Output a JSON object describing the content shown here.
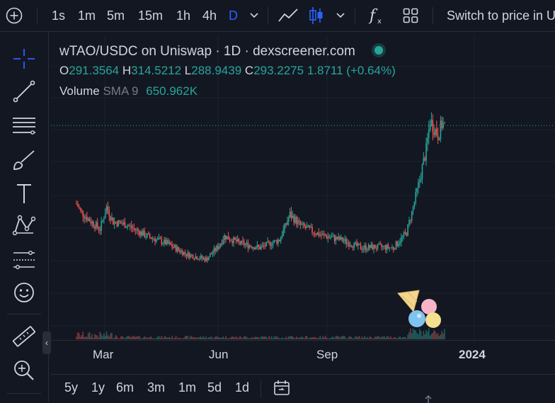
{
  "toolbar": {
    "timeframes": [
      "1s",
      "1m",
      "5m",
      "15m",
      "1h",
      "4h",
      "D"
    ],
    "active_timeframe": "D",
    "switch_label": "Switch to price in U"
  },
  "legend": {
    "title": "wTAO/USDC on Uniswap · 1D · dexscreener.com",
    "o_label": "O",
    "o": "291.3564",
    "h_label": "H",
    "h": "314.5212",
    "l_label": "L",
    "l": "288.9439",
    "c_label": "C",
    "c": "293.2275",
    "change": "1.8711 (+0.64%)",
    "volume_label": "Volume",
    "sma_label": "SMA 9",
    "volume_value": "650.962K"
  },
  "xaxis": {
    "labels": [
      "Mar",
      "Jun",
      "Sep",
      "2024"
    ]
  },
  "ranges": [
    "5y",
    "1y",
    "6m",
    "3m",
    "1m",
    "5d",
    "1d"
  ],
  "colors": {
    "up": "#26a69a",
    "down": "#ef5350",
    "accent": "#2962ff",
    "background": "#131722"
  },
  "chart_data": {
    "type": "candlestick",
    "x_start": "2023-02-15",
    "x_end": "2023-12-06",
    "x_ticks": [
      "Mar",
      "Jun",
      "Sep",
      "2024"
    ],
    "y_range": [
      60,
      320
    ],
    "price_line": 293.2275,
    "series": [
      {
        "date": "2023-02-15",
        "value": 185
      },
      {
        "date": "2023-02-18",
        "value": 175
      },
      {
        "date": "2023-02-25",
        "value": 162
      },
      {
        "date": "2023-03-05",
        "value": 150
      },
      {
        "date": "2023-03-10",
        "value": 180
      },
      {
        "date": "2023-03-15",
        "value": 160
      },
      {
        "date": "2023-03-25",
        "value": 156
      },
      {
        "date": "2023-04-10",
        "value": 140
      },
      {
        "date": "2023-04-25",
        "value": 130
      },
      {
        "date": "2023-05-10",
        "value": 115
      },
      {
        "date": "2023-05-25",
        "value": 108
      },
      {
        "date": "2023-06-03",
        "value": 125
      },
      {
        "date": "2023-06-08",
        "value": 140
      },
      {
        "date": "2023-06-20",
        "value": 130
      },
      {
        "date": "2023-07-05",
        "value": 124
      },
      {
        "date": "2023-07-20",
        "value": 135
      },
      {
        "date": "2023-07-28",
        "value": 170
      },
      {
        "date": "2023-08-05",
        "value": 155
      },
      {
        "date": "2023-08-20",
        "value": 142
      },
      {
        "date": "2023-09-05",
        "value": 135
      },
      {
        "date": "2023-09-20",
        "value": 124
      },
      {
        "date": "2023-10-05",
        "value": 125
      },
      {
        "date": "2023-10-15",
        "value": 124
      },
      {
        "date": "2023-10-25",
        "value": 145
      },
      {
        "date": "2023-10-30",
        "value": 180
      },
      {
        "date": "2023-11-03",
        "value": 210
      },
      {
        "date": "2023-11-06",
        "value": 235
      },
      {
        "date": "2023-11-09",
        "value": 260
      },
      {
        "date": "2023-11-12",
        "value": 300
      },
      {
        "date": "2023-11-15",
        "value": 290
      },
      {
        "date": "2023-11-18",
        "value": 280
      },
      {
        "date": "2023-11-21",
        "value": 295
      },
      {
        "date": "2023-11-23",
        "value": 293
      }
    ]
  }
}
